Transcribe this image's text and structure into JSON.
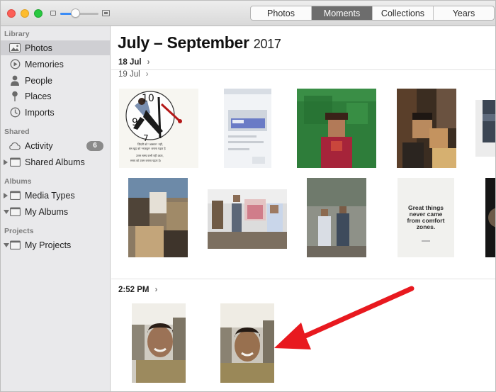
{
  "toolbar": {
    "tabs": [
      "Photos",
      "Moments",
      "Collections",
      "Years"
    ],
    "active_tab": "Moments",
    "zoom_level": 0.4
  },
  "sidebar": {
    "library_header": "Library",
    "library_items": [
      {
        "label": "Photos",
        "icon": "photos-icon",
        "selected": true
      },
      {
        "label": "Memories",
        "icon": "memories-icon"
      },
      {
        "label": "People",
        "icon": "people-icon"
      },
      {
        "label": "Places",
        "icon": "places-icon"
      },
      {
        "label": "Imports",
        "icon": "imports-icon"
      }
    ],
    "shared_header": "Shared",
    "shared_items": [
      {
        "label": "Activity",
        "icon": "cloud-icon",
        "badge": "6"
      },
      {
        "label": "Shared Albums",
        "icon": "folder-icon"
      }
    ],
    "albums_header": "Albums",
    "album_items": [
      {
        "label": "Media Types",
        "icon": "folder-icon"
      },
      {
        "label": "My Albums",
        "icon": "folder-icon"
      }
    ],
    "projects_header": "Projects",
    "project_items": [
      {
        "label": "My Projects",
        "icon": "folder-icon"
      }
    ]
  },
  "main": {
    "title": "July – September",
    "title_year": "2017",
    "moments": [
      {
        "label": "18 Jul",
        "chevron": "›"
      },
      {
        "label": "19 Jul",
        "chevron": "›"
      },
      {
        "label": "2:52 PM",
        "chevron": "›"
      }
    ],
    "quote_card": {
      "text_lines": [
        "Great things",
        "never came",
        "from comfort",
        "zones."
      ]
    },
    "hindi_card": {
      "text_lines": [
        "ज़िंदगी को \"आसान\" नहीं,",
        "बस खुद को \"मज़बूत\" बनाना पड़ता है",
        "उत्तम समय कभी नहीं आता,",
        "समय को उत्तम बनाना पड़ता है।"
      ],
      "clock_numbers": [
        "10",
        "9",
        "7"
      ]
    }
  },
  "annotation": {
    "arrow_color": "#e8191f"
  }
}
